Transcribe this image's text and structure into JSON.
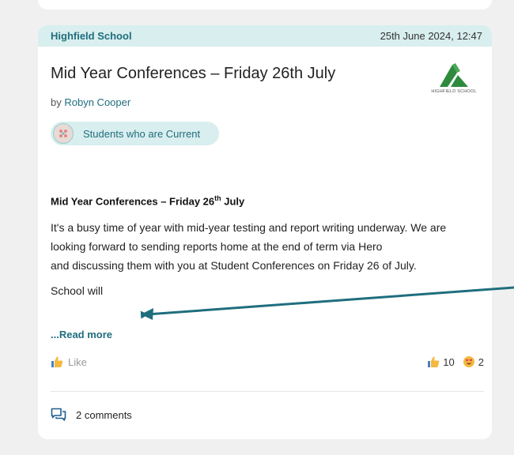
{
  "post": {
    "school": "Highfield School",
    "timestamp": "25th June 2024, 12:47",
    "title": "Mid Year Conferences – Friday 26th July",
    "author_prefix": "by",
    "author": "Robyn Cooper",
    "logo_caption": "HIGHFIELD SCHOOL",
    "audience": "Students who are Current",
    "body_heading_main": "Mid Year Conferences – Friday 26",
    "body_heading_sup": "th",
    "body_heading_end": " July",
    "body_lines": [
      "It's a busy time of year with mid-year testing and report writing underway. We are",
      "looking forward to sending reports home at the end of term via Hero",
      "and discussing them with you at Student Conferences on Friday 26 of July."
    ],
    "body_line_2": "School will",
    "read_more": "...Read more",
    "like_label": "Like",
    "reactions": [
      {
        "icon": "thumbs-up-icon",
        "count": "10"
      },
      {
        "icon": "heart-eyes-icon",
        "count": "2"
      }
    ],
    "comments": "2 comments"
  },
  "colors": {
    "accent": "#1f6e7e",
    "header_bg": "#d9eeee",
    "logo_green": "#2e8b3e",
    "arrow": "#1f6e7e"
  }
}
